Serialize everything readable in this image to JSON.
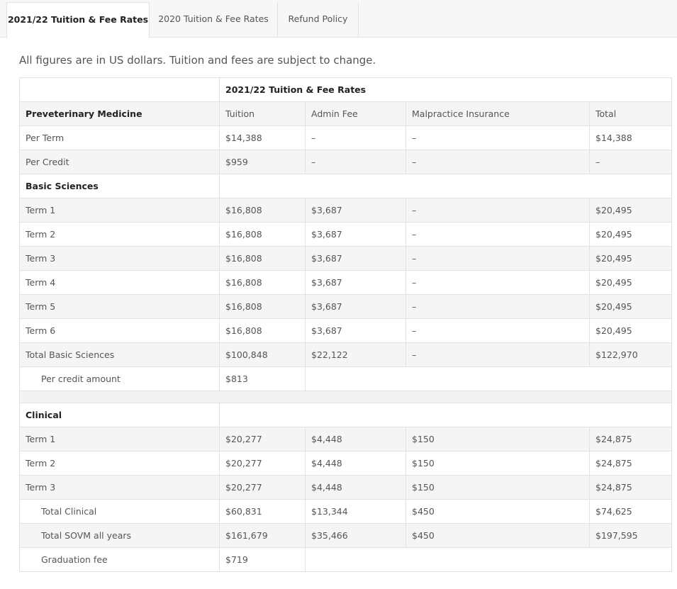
{
  "tabs": [
    {
      "label": "2021/22 Tuition & Fee Rates"
    },
    {
      "label": "2020 Tuition & Fee Rates"
    },
    {
      "label": "Refund Policy"
    }
  ],
  "note": "All figures are in US dollars. Tuition and fees are subject to change.",
  "table": {
    "caption": "2021/22 Tuition & Fee Rates",
    "preveterinary": {
      "heading": "Preveterinary Medicine",
      "cols": [
        "Tuition",
        "Admin Fee",
        "Malpractice Insurance",
        "Total"
      ],
      "rows": [
        [
          "Per Term",
          "$14,388",
          "–",
          "–",
          "$14,388"
        ],
        [
          "Per Credit",
          "$959",
          "–",
          "–",
          "–"
        ]
      ]
    },
    "basic": {
      "heading": "Basic Sciences",
      "rows": [
        [
          "Term 1",
          "$16,808",
          "$3,687",
          "–",
          "$20,495"
        ],
        [
          "Term 2",
          "$16,808",
          "$3,687",
          "–",
          "$20,495"
        ],
        [
          "Term 3",
          "$16,808",
          "$3,687",
          "–",
          "$20,495"
        ],
        [
          "Term 4",
          "$16,808",
          "$3,687",
          "–",
          "$20,495"
        ],
        [
          "Term 5",
          "$16,808",
          "$3,687",
          "–",
          "$20,495"
        ],
        [
          "Term 6",
          "$16,808",
          "$3,687",
          "–",
          "$20,495"
        ],
        [
          "Total Basic Sciences",
          "$100,848",
          "$22,122",
          "–",
          "$122,970"
        ]
      ],
      "per_credit": [
        "Per credit amount",
        "$813"
      ]
    },
    "clinical": {
      "heading": "Clinical",
      "rows": [
        [
          "Term 1",
          "$20,277",
          "$4,448",
          "$150",
          "$24,875"
        ],
        [
          "Term 2",
          "$20,277",
          "$4,448",
          "$150",
          "$24,875"
        ],
        [
          "Term 3",
          "$20,277",
          "$4,448",
          "$150",
          "$24,875"
        ]
      ],
      "total_clinical": [
        "Total Clinical",
        "$60,831",
        "$13,344",
        "$450",
        "$74,625"
      ],
      "total_sovm": [
        "Total SOVM all years",
        "$161,679",
        "$35,466",
        "$450",
        "$197,595"
      ],
      "graduation": [
        "Graduation fee",
        "$719"
      ]
    }
  }
}
